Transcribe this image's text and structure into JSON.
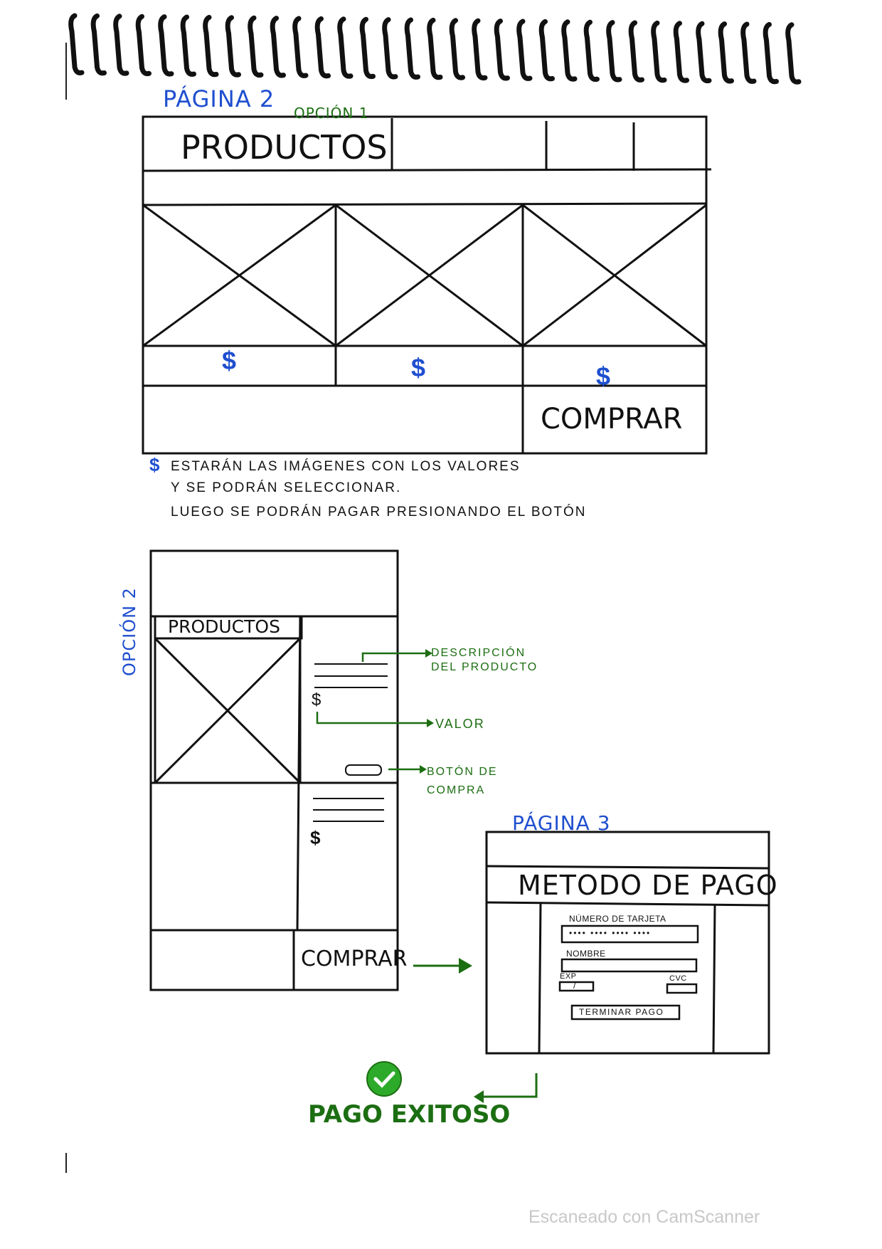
{
  "page2": {
    "heading": "PÁGINA 2",
    "option_label": "OPCIÓN 1",
    "title": "PRODUCTOS",
    "prices": [
      "$",
      "$",
      "$"
    ],
    "buy_button": "COMPRAR",
    "note_symbol": "$",
    "note_lines": [
      "ESTARÁN LAS IMÁGENES CON LOS VALORES",
      "Y SE PODRÁN SELECCIONAR.",
      "LUEGO SE PODRÁN PAGAR PRESIONANDO EL BOTÓN"
    ]
  },
  "option2": {
    "option_label": "OPCIÓN 2",
    "title": "PRODUCTOS",
    "prices": [
      "$",
      "$"
    ],
    "buy_button": "COMPRAR",
    "annotations": {
      "description": [
        "DESCRIPCIÓN",
        "DEL PRODUCTO"
      ],
      "value": "VALOR",
      "buy": [
        "BOTÓN DE",
        "COMPRA"
      ]
    }
  },
  "page3": {
    "heading": "PÁGINA 3",
    "title": "METODO DE PAGO",
    "card_label": "NÚMERO DE TARJETA",
    "card_value": "•••• •••• •••• ••••",
    "name_label": "NOMBRE",
    "exp_label": "EXP",
    "exp_value": "/",
    "cvc_label": "CVC",
    "finish_button": "TERMINAR PAGO"
  },
  "success": {
    "label": "PAGO EXITOSO"
  },
  "footer": {
    "watermark": "Escaneado con CamScanner"
  },
  "colors": {
    "ink": "#111111",
    "blue": "#1f4fd0",
    "green": "#1c6e12",
    "check": "#2eaa2a"
  }
}
